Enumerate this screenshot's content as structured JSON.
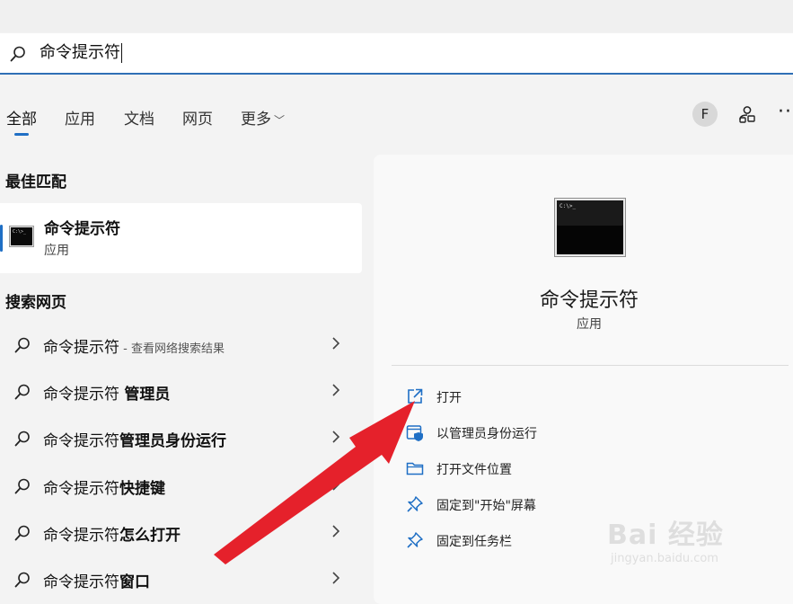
{
  "search": {
    "value": "命令提示符"
  },
  "tabs": [
    {
      "label": "全部",
      "active": true
    },
    {
      "label": "应用"
    },
    {
      "label": "文档"
    },
    {
      "label": "网页"
    },
    {
      "label": "更多"
    }
  ],
  "account": {
    "avatar_letter": "F"
  },
  "best_match": {
    "section_title": "最佳匹配",
    "title": "命令提示符",
    "subtitle": "应用"
  },
  "web_search": {
    "section_title": "搜索网页",
    "items": [
      {
        "prefix": "命令提示符",
        "bold": "",
        "hint": " - 查看网络搜索结果"
      },
      {
        "prefix": "命令提示符 ",
        "bold": "管理员",
        "hint": ""
      },
      {
        "prefix": "命令提示符",
        "bold": "管理员身份运行",
        "hint": ""
      },
      {
        "prefix": "命令提示符",
        "bold": "快捷键",
        "hint": ""
      },
      {
        "prefix": "命令提示符",
        "bold": "怎么打开",
        "hint": ""
      },
      {
        "prefix": "命令提示符",
        "bold": "窗口",
        "hint": ""
      }
    ]
  },
  "detail": {
    "title": "命令提示符",
    "subtitle": "应用",
    "actions": [
      {
        "label": "打开",
        "icon": "open-external-icon"
      },
      {
        "label": "以管理员身份运行",
        "icon": "shield-admin-icon"
      },
      {
        "label": "打开文件位置",
        "icon": "folder-icon"
      },
      {
        "label": "固定到\"开始\"屏幕",
        "icon": "pin-icon"
      },
      {
        "label": "固定到任务栏",
        "icon": "pin-icon"
      }
    ]
  },
  "watermark": {
    "brand": "Bai 经验",
    "url": "jingyan.baidu.com"
  },
  "colors": {
    "accent": "#1f6fc5",
    "arrow": "#e5212b"
  }
}
